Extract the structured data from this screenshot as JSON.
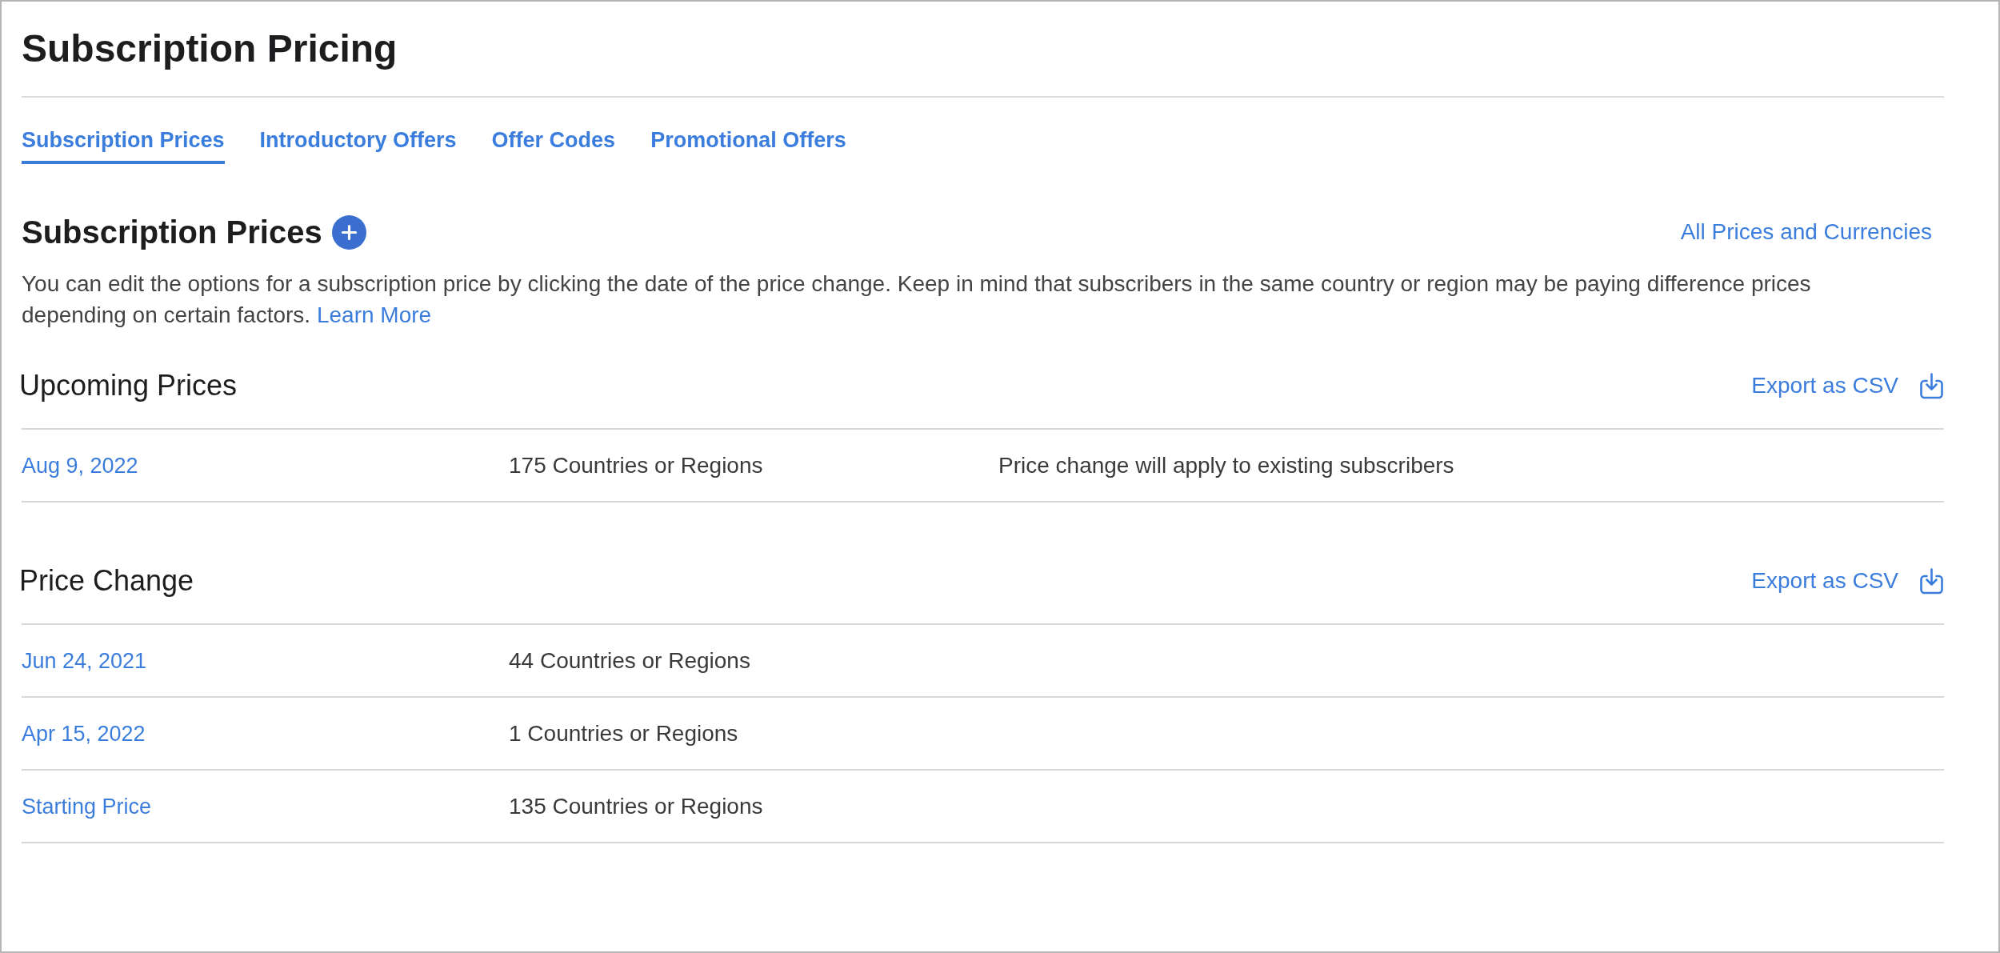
{
  "page": {
    "title": "Subscription Pricing"
  },
  "tabs": [
    {
      "label": "Subscription Prices",
      "selected": true
    },
    {
      "label": "Introductory Offers",
      "selected": false
    },
    {
      "label": "Offer Codes",
      "selected": false
    },
    {
      "label": "Promotional Offers",
      "selected": false
    }
  ],
  "section": {
    "title": "Subscription Prices",
    "link": "All Prices and Currencies",
    "description": "You can edit the options for a subscription price by clicking the date of the price change. Keep in mind that subscribers in the same country or region may be paying difference prices depending on certain factors.",
    "learn_more": "Learn More"
  },
  "tables": [
    {
      "title": "Upcoming Prices",
      "export": "Export as CSV",
      "rows": [
        {
          "date": "Aug 9, 2022",
          "regions": "175 Countries or Regions",
          "note": "Price change will apply to existing subscribers"
        }
      ]
    },
    {
      "title": "Price Change",
      "export": "Export as CSV",
      "rows": [
        {
          "date": "Jun 24, 2021",
          "regions": "44 Countries or Regions"
        },
        {
          "date": "Apr 15, 2022",
          "regions": "1 Countries or Regions"
        },
        {
          "date": "Starting Price",
          "regions": "135 Countries or Regions"
        }
      ]
    }
  ]
}
